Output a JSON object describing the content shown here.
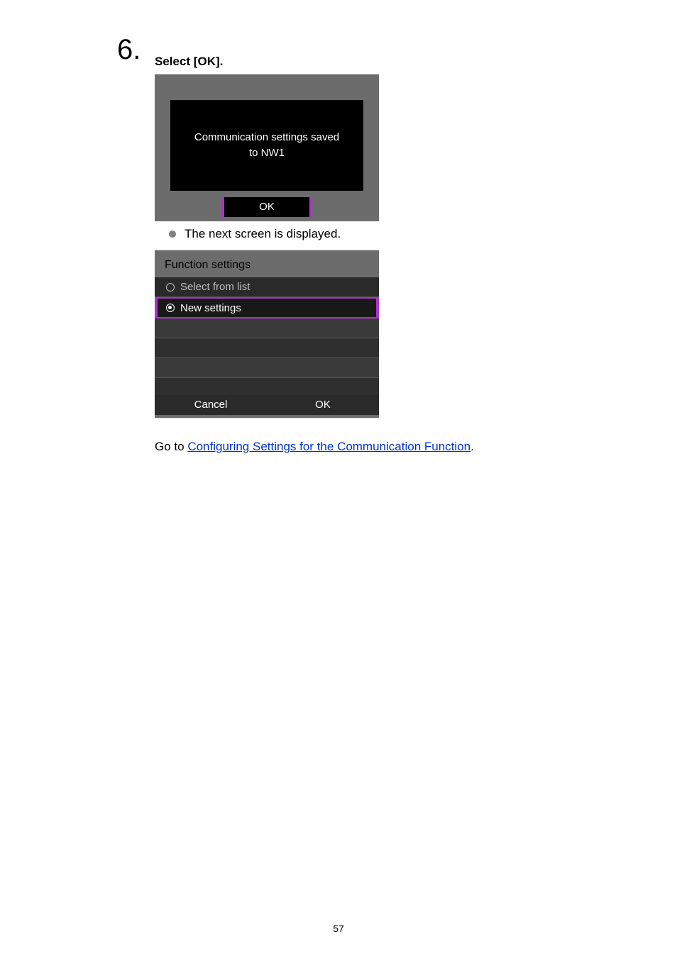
{
  "step": {
    "number": "6.",
    "title": "Select [OK]."
  },
  "screenshot1": {
    "message_line1": "Communication settings saved",
    "message_line2": "to NW1",
    "ok_label": "OK"
  },
  "bullet_text": "The next screen is displayed.",
  "screenshot2": {
    "title": "Function settings",
    "options": [
      {
        "label": "Select from list",
        "selected": false
      },
      {
        "label": "New settings",
        "selected": true
      }
    ],
    "cancel_label": "Cancel",
    "ok_label": "OK"
  },
  "goto": {
    "prefix": "Go to ",
    "link_text": "Configuring Settings for the Communication Function",
    "suffix": "."
  },
  "page_number": "57"
}
